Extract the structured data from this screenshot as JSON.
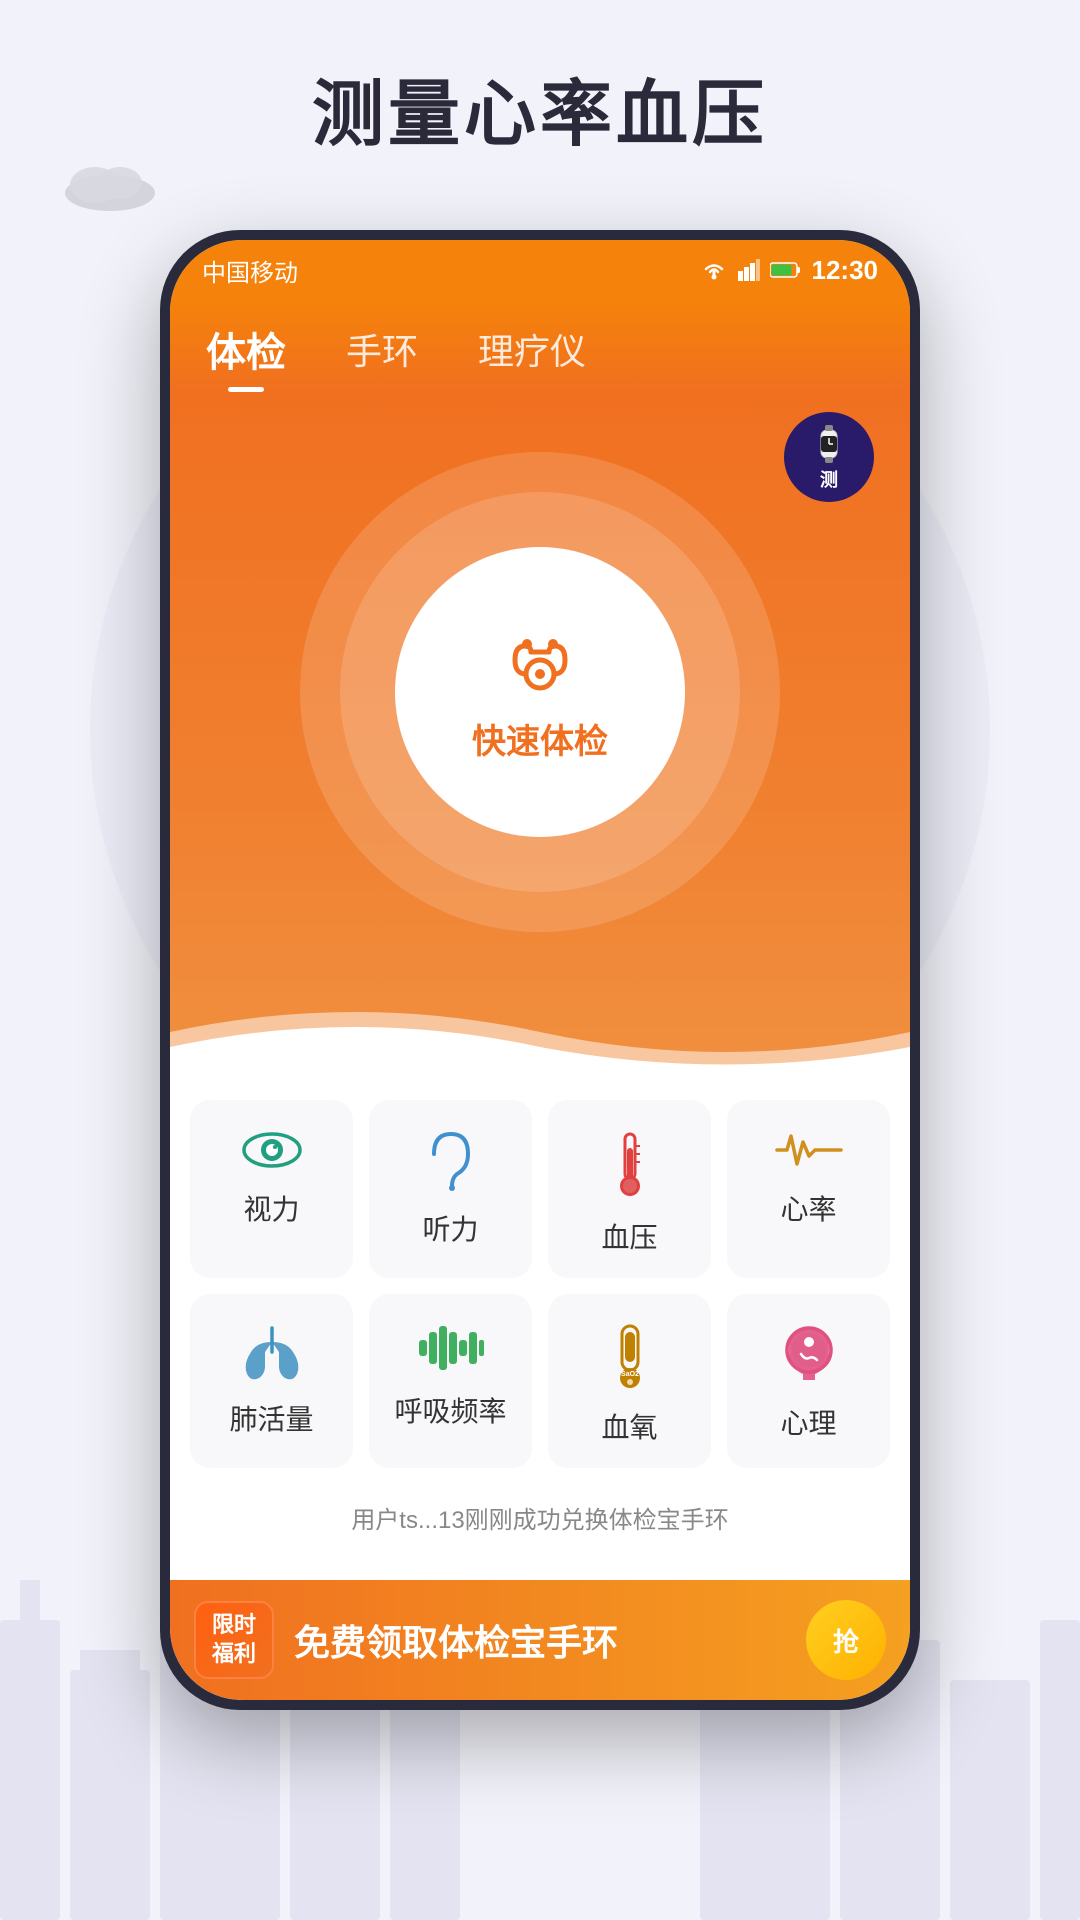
{
  "page": {
    "title": "测量心率血压",
    "background_color": "#f2f2fa"
  },
  "status_bar": {
    "carrier": "中国移动",
    "time": "12:30",
    "wifi": "▼",
    "signal": "▲",
    "battery": "🔋"
  },
  "tabs": [
    {
      "id": "exam",
      "label": "体检",
      "active": true
    },
    {
      "id": "band",
      "label": "手环",
      "active": false
    },
    {
      "id": "therapy",
      "label": "理疗仪",
      "active": false
    }
  ],
  "main_button": {
    "icon": "🩺",
    "label": "快速体检"
  },
  "wristband_badge": {
    "icon": "⌚",
    "label": "测"
  },
  "health_items_row1": [
    {
      "id": "vision",
      "icon": "👁",
      "label": "视力",
      "color": "#20a080"
    },
    {
      "id": "hearing",
      "icon": "👂",
      "label": "听力",
      "color": "#4090d0"
    },
    {
      "id": "blood_pressure",
      "icon": "🌡",
      "label": "血压",
      "color": "#e04040"
    },
    {
      "id": "heart_rate",
      "icon": "💓",
      "label": "心率",
      "color": "#d09020"
    }
  ],
  "health_items_row2": [
    {
      "id": "lung",
      "icon": "🫁",
      "label": "肺活量",
      "color": "#4090c0"
    },
    {
      "id": "breath",
      "icon": "🫀",
      "label": "呼吸频率",
      "color": "#40b060"
    },
    {
      "id": "blood_oxygen",
      "icon": "🧪",
      "label": "血氧",
      "color": "#c08000"
    },
    {
      "id": "mental",
      "icon": "🧠",
      "label": "心理",
      "color": "#e05080"
    }
  ],
  "notification": {
    "text": "用户ts...13刚刚成功兑换体检宝手环"
  },
  "banner": {
    "badge_line1": "限时",
    "badge_line2": "福利",
    "main_text": "免费领取体检宝手环",
    "button_label": "抢"
  }
}
